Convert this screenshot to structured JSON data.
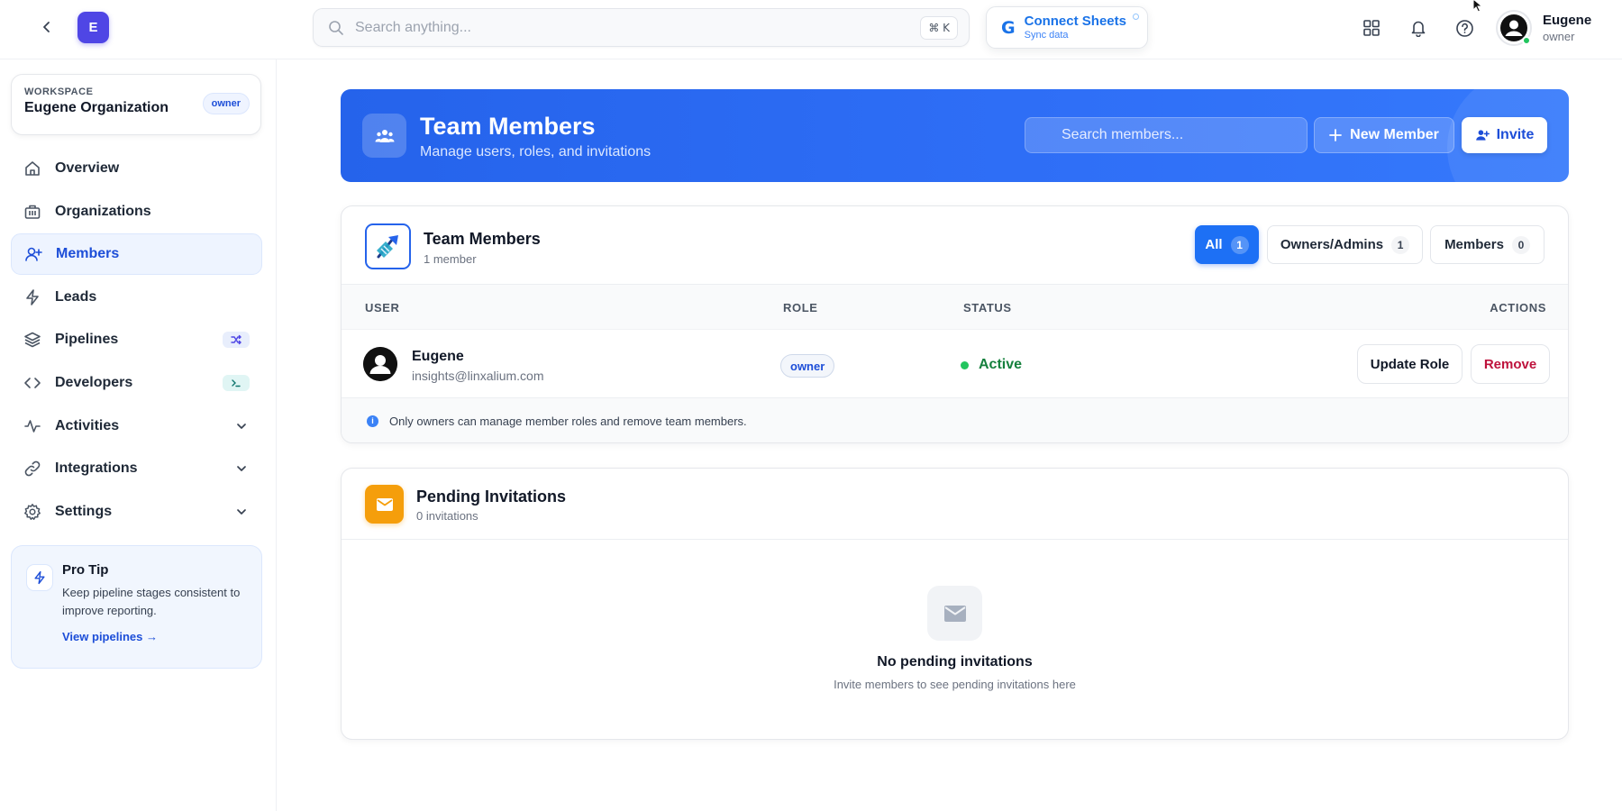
{
  "topbar": {
    "logo_letter": "E",
    "search_placeholder": "Search anything...",
    "search_shortcut": "⌘ K",
    "connect_title": "Connect Sheets",
    "connect_sub": "Sync data",
    "connect_logo": "G",
    "user_name": "Eugene",
    "user_role": "owner",
    "icons": [
      "back-icon",
      "apps-grid-icon",
      "bell-icon",
      "help-icon",
      "user-avatar-icon"
    ]
  },
  "sidebar": {
    "workspace_label": "WORKSPACE",
    "workspace_name": "Eugene Organization",
    "workspace_role": "owner",
    "items": [
      {
        "label": "Overview",
        "icon": "home-icon"
      },
      {
        "label": "Organizations",
        "icon": "building-icon"
      },
      {
        "label": "Members",
        "icon": "user-plus-icon",
        "active": true
      },
      {
        "label": "Leads",
        "icon": "bolt-icon"
      },
      {
        "label": "Pipelines",
        "icon": "layers-icon",
        "badge_icon": "shuffle-icon"
      },
      {
        "label": "Developers",
        "icon": "code-icon",
        "badge_icon": "terminal-icon"
      },
      {
        "label": "Activities",
        "icon": "activity-icon",
        "expandable": true
      },
      {
        "label": "Integrations",
        "icon": "link-icon",
        "expandable": true
      },
      {
        "label": "Settings",
        "icon": "gear-icon",
        "expandable": true
      }
    ],
    "protip": {
      "title": "Pro Tip",
      "text": "Keep pipeline stages consistent to improve reporting.",
      "link": "View pipelines →"
    }
  },
  "hero": {
    "title": "Team Members",
    "subtitle": "Manage users, roles, and invitations",
    "search_placeholder": "Search members...",
    "new_member_label": "New Member",
    "invite_label": "Invite"
  },
  "members_card": {
    "title": "Team Members",
    "subtitle": "1 member",
    "filters": [
      {
        "label": "All",
        "count": "1",
        "active": true
      },
      {
        "label": "Owners/Admins",
        "count": "1"
      },
      {
        "label": "Members",
        "count": "0"
      }
    ],
    "columns": [
      "USER",
      "ROLE",
      "STATUS",
      "ACTIONS"
    ],
    "rows": [
      {
        "name": "Eugene",
        "email": "insights@linxalium.com",
        "role": "owner",
        "status": "Active",
        "actions": [
          "Update Role",
          "Remove"
        ]
      }
    ],
    "note": "Only owners can manage member roles and remove team members."
  },
  "invites_card": {
    "title": "Pending Invitations",
    "subtitle": "0 invitations",
    "empty_title": "No pending invitations",
    "empty_sub": "Invite members to see pending invitations here"
  },
  "colors": {
    "accent": "#2563eb",
    "active_status": "#15803d",
    "danger": "#be123c",
    "mail_tile": "#f59e0b"
  }
}
